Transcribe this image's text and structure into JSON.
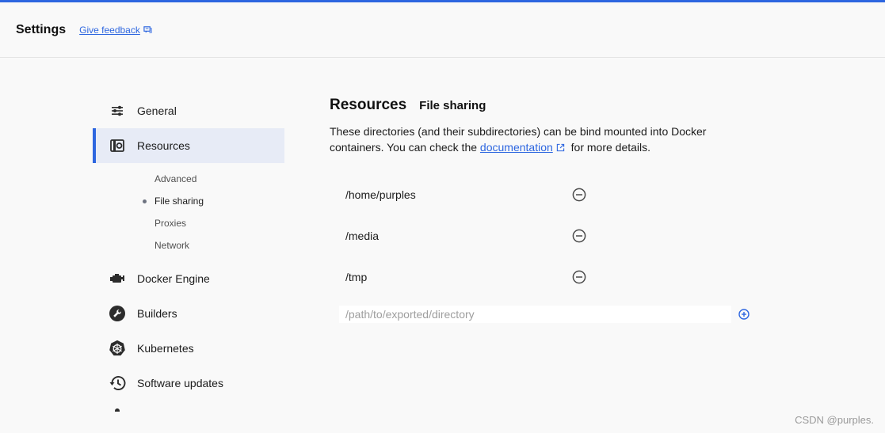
{
  "header": {
    "title": "Settings",
    "feedback_label": "Give feedback",
    "accent_color": "#2d66e0"
  },
  "sidebar": {
    "items": [
      {
        "label": "General",
        "icon": "sliders-icon"
      },
      {
        "label": "Resources",
        "icon": "resources-icon",
        "active": true
      },
      {
        "label": "Docker Engine",
        "icon": "engine-icon"
      },
      {
        "label": "Builders",
        "icon": "wrench-icon"
      },
      {
        "label": "Kubernetes",
        "icon": "kubernetes-icon"
      },
      {
        "label": "Software updates",
        "icon": "history-icon"
      }
    ],
    "sub_items": [
      {
        "label": "Advanced"
      },
      {
        "label": "File sharing",
        "active": true
      },
      {
        "label": "Proxies"
      },
      {
        "label": "Network"
      }
    ]
  },
  "main": {
    "title": "Resources",
    "subtitle": "File sharing",
    "description_before": "These directories (and their subdirectories) can be bind mounted into Docker containers. You can check the ",
    "description_link": "documentation",
    "description_after": " for more details.",
    "directories": [
      "/home/purples",
      "/media",
      "/tmp"
    ],
    "new_path_placeholder": "/path/to/exported/directory",
    "new_path_value": ""
  },
  "watermark": "CSDN @purples."
}
